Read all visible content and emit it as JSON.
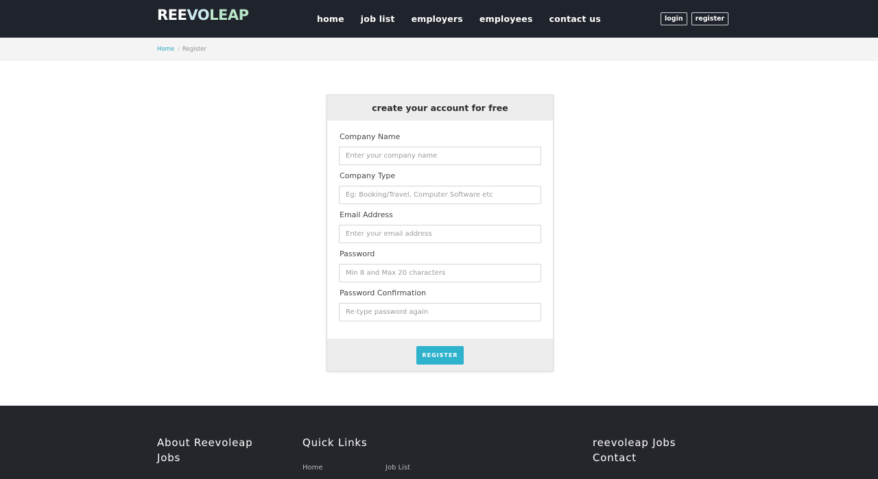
{
  "header": {
    "logo": {
      "part1": "REE",
      "part2": "VO",
      "part3": "LEAP"
    },
    "nav": [
      "home",
      "job list",
      "employers",
      "employees",
      "contact us"
    ],
    "login_label": "login",
    "register_label": "register"
  },
  "breadcrumb": {
    "home": "Home",
    "separator": "/",
    "current": "Register"
  },
  "form": {
    "title": "create your account for free",
    "fields": [
      {
        "label": "Company Name",
        "placeholder": "Enter your company name",
        "value": ""
      },
      {
        "label": "Company Type",
        "placeholder": "Eg: Booking/Travel, Computer Software etc",
        "value": ""
      },
      {
        "label": "Email Address",
        "placeholder": "Enter your email address",
        "value": ""
      },
      {
        "label": "Password",
        "placeholder": "Min 8 and Max 20 characters",
        "value": ""
      },
      {
        "label": "Password Confirmation",
        "placeholder": "Re-type password again",
        "value": ""
      }
    ],
    "submit_label": "REGISTER"
  },
  "footer": {
    "about_title": "About Reevoleap Jobs",
    "quick_links_title": "Quick Links",
    "quick_links": [
      "Home",
      "Job List"
    ],
    "contact_title": "reevoleap Jobs Contact"
  },
  "colors": {
    "header_bg": "#1f232b",
    "accent": "#2fb2cc",
    "footer_bg": "#25262c",
    "breadcrumb_bg": "#f4f4f4"
  }
}
